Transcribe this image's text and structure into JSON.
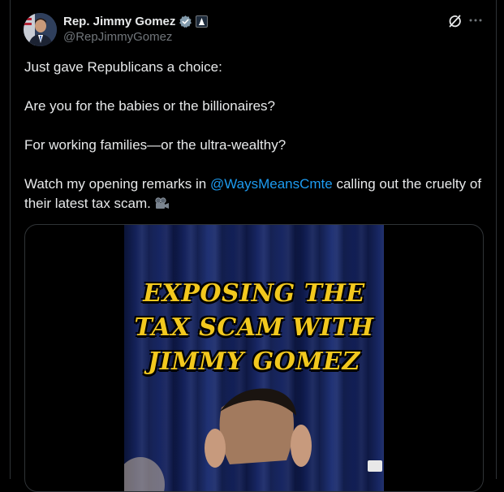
{
  "post": {
    "author_name": "Rep. Jimmy Gomez",
    "handle": "@RepJimmyGomez",
    "paragraphs": [
      "Just gave Republicans a choice:",
      "Are you for the babies or the billionaires?",
      "For working families—or the ultra-wealthy?"
    ],
    "last_paragraph": {
      "before_mention": "Watch my opening remarks in ",
      "mention": "@WaysMeansCmte",
      "after_mention": " calling out the cruelty of their latest tax scam."
    },
    "media": {
      "title_lines": [
        "EXPOSING THE",
        "TAX SCAM WITH",
        "JIMMY GOMEZ"
      ]
    }
  },
  "icons": {
    "verified": "verified-badge-icon",
    "government": "government-badge-icon",
    "grok": "grok-icon",
    "more": "more-icon",
    "camera": "video-camera-icon"
  },
  "colors": {
    "background": "#000000",
    "text": "#e7e9ea",
    "secondary": "#71767b",
    "link": "#1d9bf0",
    "title_yellow": "#f2c81e"
  }
}
